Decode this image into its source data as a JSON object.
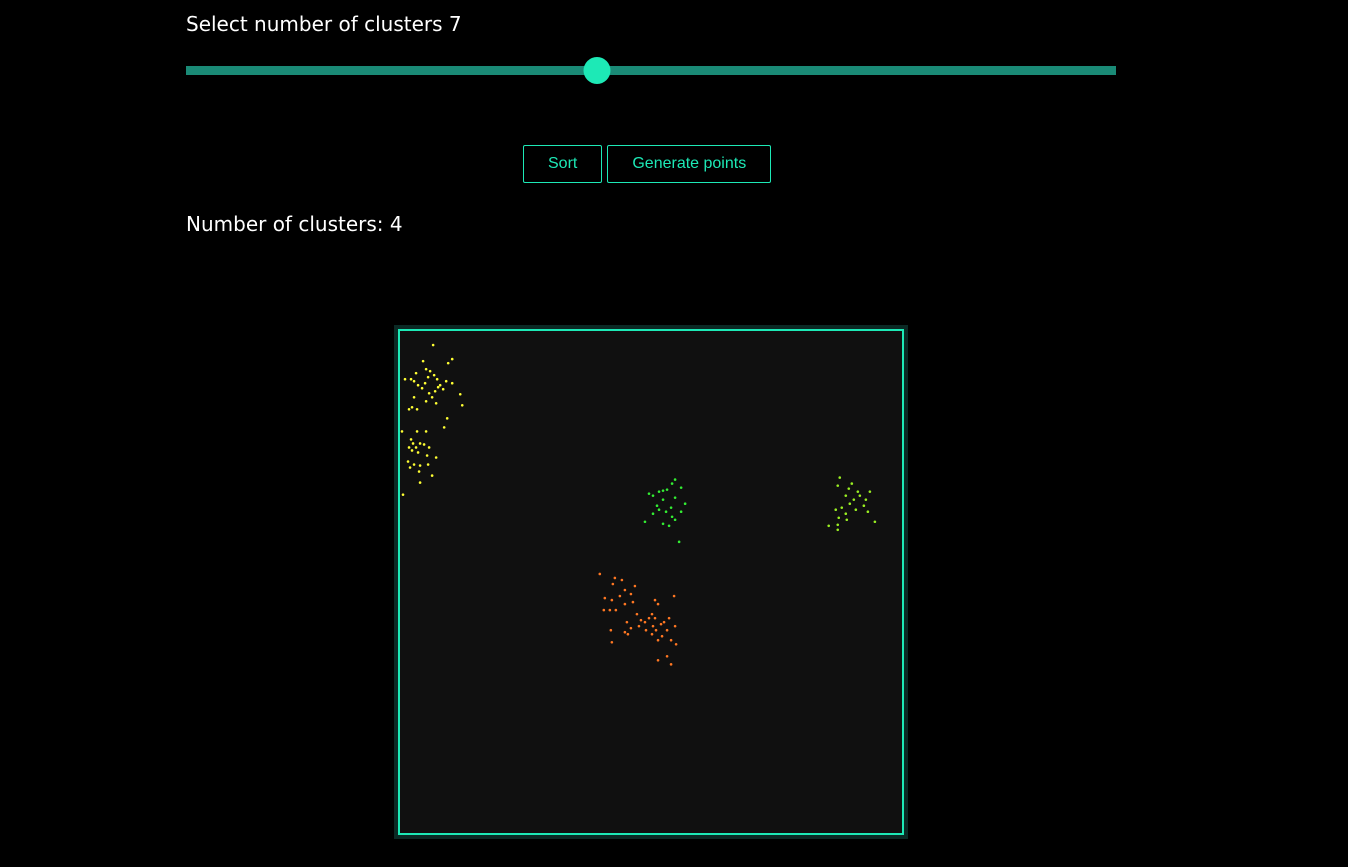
{
  "slider": {
    "label": "Select number of clusters 7",
    "min": 1,
    "max": 10,
    "value": 7,
    "track_color": "#1a8a76",
    "thumb_color": "#1de9b6"
  },
  "buttons": {
    "sort_label": "Sort",
    "generate_label": "Generate points",
    "accent_color": "#1de9b6"
  },
  "result": {
    "clusters_text": "Number of clusters: 4"
  },
  "canvas": {
    "border_color": "#1de9b6",
    "background": "#101010"
  },
  "chart_data": {
    "type": "scatter",
    "xlim": [
      0,
      500
    ],
    "ylim": [
      0,
      500
    ],
    "series": [
      {
        "color": "#ffff33",
        "points": [
          [
            33,
            14
          ],
          [
            52,
            28
          ],
          [
            48,
            32
          ],
          [
            23,
            30
          ],
          [
            26,
            38
          ],
          [
            16,
            42
          ],
          [
            30,
            40
          ],
          [
            34,
            44
          ],
          [
            37,
            48
          ],
          [
            28,
            46
          ],
          [
            25,
            52
          ],
          [
            40,
            54
          ],
          [
            46,
            50
          ],
          [
            52,
            52
          ],
          [
            18,
            54
          ],
          [
            5,
            48
          ],
          [
            11,
            48
          ],
          [
            14,
            50
          ],
          [
            38,
            56
          ],
          [
            22,
            57
          ],
          [
            35,
            60
          ],
          [
            43,
            58
          ],
          [
            29,
            62
          ],
          [
            60,
            63
          ],
          [
            32,
            66
          ],
          [
            14,
            66
          ],
          [
            26,
            70
          ],
          [
            36,
            72
          ],
          [
            12,
            76
          ],
          [
            17,
            78
          ],
          [
            62,
            74
          ],
          [
            9,
            78
          ],
          [
            47,
            87
          ],
          [
            44,
            96
          ],
          [
            2,
            100
          ],
          [
            17,
            100
          ],
          [
            26,
            100
          ],
          [
            11,
            108
          ],
          [
            13,
            112
          ],
          [
            20,
            112
          ],
          [
            24,
            113
          ],
          [
            9,
            116
          ],
          [
            16,
            116
          ],
          [
            29,
            116
          ],
          [
            12,
            119
          ],
          [
            18,
            121
          ],
          [
            27,
            124
          ],
          [
            8,
            130
          ],
          [
            36,
            126
          ],
          [
            14,
            133
          ],
          [
            20,
            134
          ],
          [
            28,
            133
          ],
          [
            19,
            140
          ],
          [
            10,
            136
          ],
          [
            32,
            144
          ],
          [
            20,
            151
          ],
          [
            3,
            163
          ]
        ]
      },
      {
        "color": "#33ee33",
        "points": [
          [
            274,
            148
          ],
          [
            271,
            152
          ],
          [
            280,
            156
          ],
          [
            266,
            158
          ],
          [
            262,
            159
          ],
          [
            258,
            160
          ],
          [
            248,
            162
          ],
          [
            252,
            164
          ],
          [
            274,
            166
          ],
          [
            262,
            168
          ],
          [
            284,
            172
          ],
          [
            256,
            174
          ],
          [
            270,
            176
          ],
          [
            258,
            178
          ],
          [
            265,
            180
          ],
          [
            280,
            180
          ],
          [
            252,
            182
          ],
          [
            271,
            185
          ],
          [
            244,
            190
          ],
          [
            274,
            188
          ],
          [
            262,
            192
          ],
          [
            268,
            194
          ],
          [
            278,
            210
          ]
        ]
      },
      {
        "color": "#99ee22",
        "points": [
          [
            438,
            146
          ],
          [
            450,
            152
          ],
          [
            436,
            154
          ],
          [
            447,
            157
          ],
          [
            456,
            160
          ],
          [
            468,
            160
          ],
          [
            444,
            164
          ],
          [
            458,
            164
          ],
          [
            452,
            168
          ],
          [
            464,
            168
          ],
          [
            448,
            172
          ],
          [
            440,
            176
          ],
          [
            462,
            174
          ],
          [
            434,
            178
          ],
          [
            454,
            178
          ],
          [
            466,
            180
          ],
          [
            444,
            182
          ],
          [
            437,
            186
          ],
          [
            473,
            190
          ],
          [
            445,
            188
          ],
          [
            436,
            193
          ],
          [
            427,
            194
          ],
          [
            436,
            198
          ]
        ]
      },
      {
        "color": "#ff7722",
        "points": [
          [
            199,
            242
          ],
          [
            214,
            246
          ],
          [
            221,
            248
          ],
          [
            212,
            252
          ],
          [
            234,
            254
          ],
          [
            224,
            258
          ],
          [
            230,
            262
          ],
          [
            219,
            264
          ],
          [
            204,
            266
          ],
          [
            211,
            268
          ],
          [
            232,
            270
          ],
          [
            224,
            272
          ],
          [
            254,
            268
          ],
          [
            273,
            264
          ],
          [
            257,
            272
          ],
          [
            215,
            278
          ],
          [
            203,
            278
          ],
          [
            209,
            278
          ],
          [
            236,
            282
          ],
          [
            251,
            282
          ],
          [
            248,
            286
          ],
          [
            240,
            288
          ],
          [
            254,
            286
          ],
          [
            268,
            286
          ],
          [
            244,
            290
          ],
          [
            226,
            290
          ],
          [
            260,
            292
          ],
          [
            263,
            290
          ],
          [
            252,
            294
          ],
          [
            274,
            294
          ],
          [
            238,
            294
          ],
          [
            230,
            296
          ],
          [
            245,
            298
          ],
          [
            255,
            298
          ],
          [
            266,
            298
          ],
          [
            224,
            300
          ],
          [
            210,
            298
          ],
          [
            227,
            302
          ],
          [
            251,
            302
          ],
          [
            261,
            304
          ],
          [
            257,
            308
          ],
          [
            270,
            308
          ],
          [
            211,
            310
          ],
          [
            275,
            312
          ],
          [
            266,
            324
          ],
          [
            257,
            328
          ],
          [
            270,
            332
          ]
        ]
      }
    ]
  }
}
